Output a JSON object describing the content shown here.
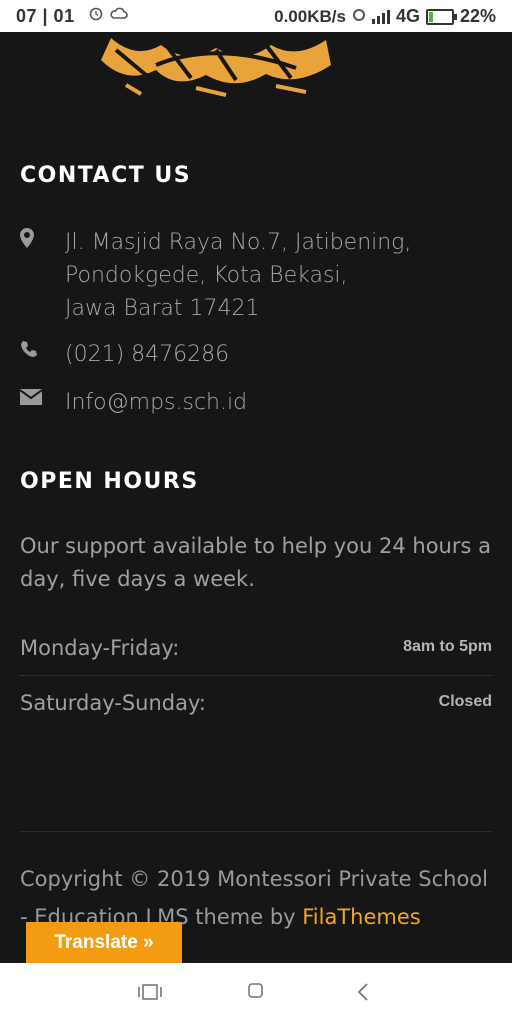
{
  "status_bar": {
    "time": "07 | 01",
    "icons": [
      "alarm-icon",
      "cloud-icon",
      "data-saver-icon",
      "signal-icon",
      "battery-charging-icon"
    ],
    "net_speed": "0.00KB/s",
    "network": "4G",
    "battery": "22%",
    "battery_level": 0.22
  },
  "contact": {
    "title": "CONTACT US",
    "address_lines": [
      "Jl. Masjid Raya No.7, Jatibening,",
      "Pondokgede, Kota Bekasi,",
      "Jawa Barat 17421"
    ],
    "phone": "(021) 8476286",
    "email": "Info@mps.sch.id",
    "icons": [
      "map-marker-icon",
      "phone-icon",
      "envelope-icon"
    ]
  },
  "open_hours": {
    "title": "OPEN HOURS",
    "description": "Our support available to help you 24 hours a day, five days a week.",
    "rows": [
      {
        "day": "Monday-Friday:",
        "time": "8am to 5pm"
      },
      {
        "day": "Saturday-Sunday:",
        "time": "Closed"
      }
    ]
  },
  "footer": {
    "copyright": "Copyright © 2019 Montessori Private School - Education LMS theme by ",
    "link_text": "FilaThemes"
  },
  "translate": {
    "label": "Translate »"
  },
  "nav": {
    "icons": [
      "recents-icon",
      "home-icon",
      "back-icon"
    ]
  },
  "colors": {
    "background": "#161617",
    "accent": "#f4a623",
    "translate_bg": "#f39c12"
  }
}
